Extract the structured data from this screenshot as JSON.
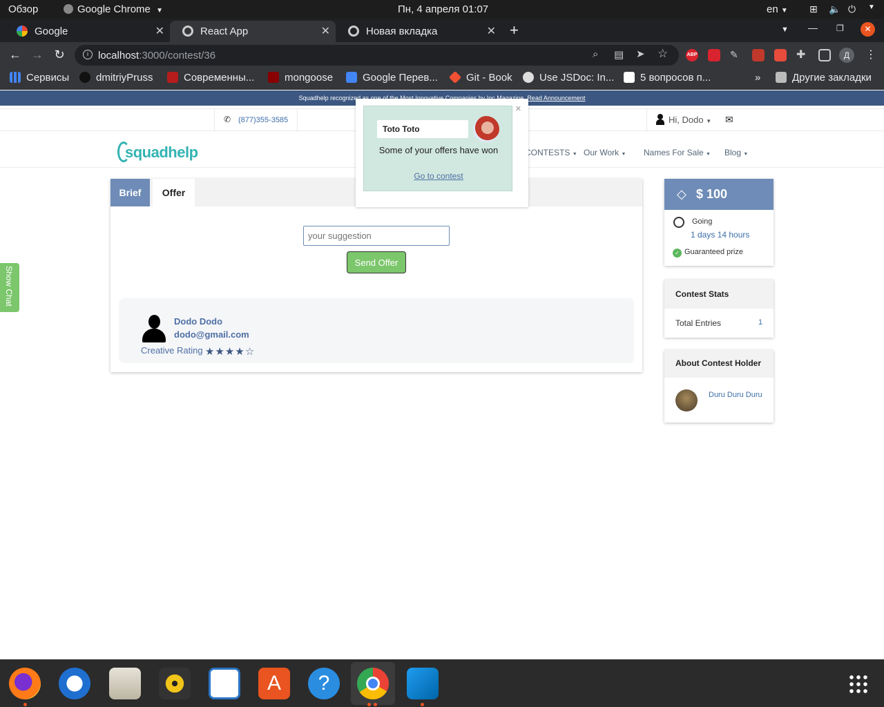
{
  "system_bar": {
    "overview": "Обзор",
    "app_name": "Google Chrome",
    "datetime": "Пн, 4 апреля  01:07",
    "lang": "en"
  },
  "tabs": [
    {
      "title": "Google",
      "active": false
    },
    {
      "title": "React App",
      "active": true
    },
    {
      "title": "Новая вкладка",
      "active": false
    }
  ],
  "address": {
    "host": "localhost",
    "rest": ":3000/contest/36"
  },
  "profile_letter": "Д",
  "bookmarks": [
    {
      "label": "Сервисы"
    },
    {
      "label": "dmitriyPruss"
    },
    {
      "label": "Современны..."
    },
    {
      "label": "mongoose"
    },
    {
      "label": "Google Перев..."
    },
    {
      "label": "Git - Book"
    },
    {
      "label": "Use JSDoc: In..."
    },
    {
      "label": "5 вопросов п..."
    }
  ],
  "bookmarks_more": "»",
  "other_bookmarks": "Другие закладки",
  "site": {
    "announcement": "Squadhelp recognized as one of the Most Innovative Companies by Inc Magazine.",
    "announcement_link": "Read Announcement",
    "phone": "(877)355-3585",
    "greeting": "Hi, Dodo",
    "logo": "squadhelp",
    "nav": [
      "CONTESTS",
      "Our Work",
      "Names For Sale",
      "Blog"
    ]
  },
  "contest": {
    "tabs": [
      "Brief",
      "Offer"
    ],
    "active_tab": "Offer",
    "suggestion_placeholder": "your suggestion",
    "send_button": "Send Offer",
    "offer": {
      "name": "Dodo Dodo",
      "email": "dodo@gmail.com",
      "rating_label": "Creative Rating",
      "rating": 4,
      "rating_max": 5
    }
  },
  "show_chat": "Show Chat",
  "notification": {
    "user": "Toto Toto",
    "message": "Some of your offers have won",
    "link": "Go to contest",
    "close": "×"
  },
  "sidebar": {
    "prize": "$ 100",
    "status": "Going",
    "time_left": "1 days 14 hours",
    "guaranteed": "Guaranteed prize",
    "stats_title": "Contest Stats",
    "total_entries_label": "Total Entries",
    "total_entries": "1",
    "holder_title": "About Contest Holder",
    "holder_name": "Duru Duru Duru"
  },
  "colors": {
    "brand_blue": "#3c5781",
    "tab_brief": "#6e8cb7",
    "send_green": "#7cc66c",
    "toast_bg": "#d1e8e0"
  }
}
